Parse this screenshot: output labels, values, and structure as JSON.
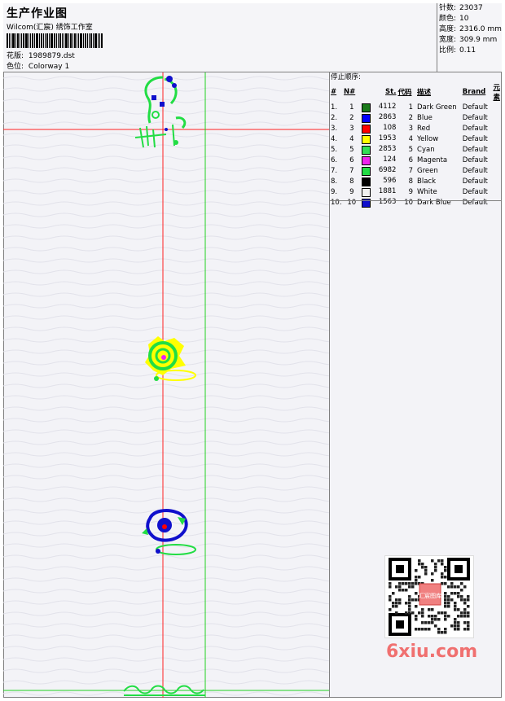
{
  "header": {
    "title": "生产作业图",
    "company": "Wilcom(汇宸) 绣饰工作室",
    "design_label": "花版:",
    "design_value": "1989879.dst",
    "colorway_label": "色位:",
    "colorway_value": "Colorway 1"
  },
  "info": [
    {
      "label": "针数:",
      "value": "23037"
    },
    {
      "label": "颜色:",
      "value": "10"
    },
    {
      "label": "高度:",
      "value": "2316.0 mm"
    },
    {
      "label": "宽度:",
      "value": "309.9 mm"
    },
    {
      "label": "比例:",
      "value": "0.11"
    }
  ],
  "stop_sequence": {
    "title": "停止顺序:",
    "headers": [
      "#",
      "N#",
      "St.",
      "代码",
      "描述",
      "Brand",
      "元素"
    ],
    "rows": [
      {
        "n": "1.",
        "needle": "1",
        "color": "#1a7a1a",
        "stitches": "4112",
        "code": "1",
        "desc": "Dark Green",
        "brand": "Default"
      },
      {
        "n": "2.",
        "needle": "2",
        "color": "#0000ff",
        "stitches": "2863",
        "code": "2",
        "desc": "Blue",
        "brand": "Default"
      },
      {
        "n": "3.",
        "needle": "3",
        "color": "#ff0000",
        "stitches": "108",
        "code": "3",
        "desc": "Red",
        "brand": "Default"
      },
      {
        "n": "4.",
        "needle": "4",
        "color": "#ffff00",
        "stitches": "1953",
        "code": "4",
        "desc": "Yellow",
        "brand": "Default"
      },
      {
        "n": "5.",
        "needle": "5",
        "color": "#33dd55",
        "stitches": "2853",
        "code": "5",
        "desc": "Cyan",
        "brand": "Default"
      },
      {
        "n": "6.",
        "needle": "6",
        "color": "#ee22ee",
        "stitches": "124",
        "code": "6",
        "desc": "Magenta",
        "brand": "Default"
      },
      {
        "n": "7.",
        "needle": "7",
        "color": "#22dd44",
        "stitches": "6982",
        "code": "7",
        "desc": "Green",
        "brand": "Default"
      },
      {
        "n": "8.",
        "needle": "8",
        "color": "#000000",
        "stitches": "596",
        "code": "8",
        "desc": "Black",
        "brand": "Default"
      },
      {
        "n": "9.",
        "needle": "9",
        "color": "#f0f0f0",
        "stitches": "1881",
        "code": "9",
        "desc": "White",
        "brand": "Default"
      },
      {
        "n": "10.",
        "needle": "10",
        "color": "#1010cc",
        "stitches": "1563",
        "code": "10",
        "desc": "Dark Blue",
        "brand": "Default"
      }
    ]
  },
  "watermark": "6xiu.com",
  "qr_stamp": "汇宸图库"
}
